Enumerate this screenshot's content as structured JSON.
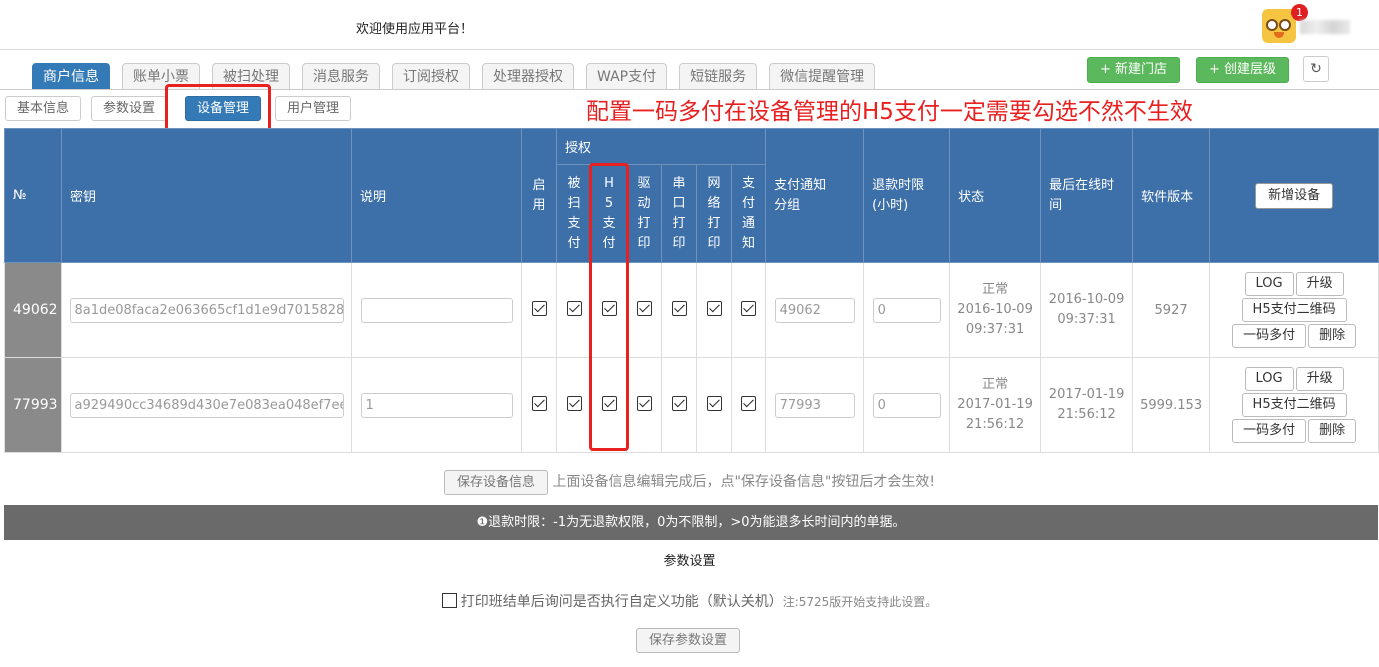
{
  "header": {
    "welcome": "欢迎使用应用平台！",
    "notification_count": "1"
  },
  "tabs": [
    "商户信息",
    "账单小票",
    "被扫处理",
    "消息服务",
    "订阅授权",
    "处理器授权",
    "WAP支付",
    "短链服务",
    "微信提醒管理"
  ],
  "actions": {
    "new_store": "+ 新建门店",
    "create_level": "+ 创建层级",
    "refresh_icon": "refresh-icon"
  },
  "subtabs": [
    "基本信息",
    "参数设置",
    "设备管理",
    "用户管理"
  ],
  "annotation": "配置一码多付在设备管理的H5支付一定需要勾选不然不生效",
  "table": {
    "headers": {
      "no": "№",
      "key": "密钥",
      "desc": "说明",
      "enable": "启用",
      "auth": "授权",
      "scan": "被扫支付",
      "h5": "H5支付",
      "driver": "驱动打印",
      "serial": "串口打印",
      "network": "网络打印",
      "paynotify": "支付通知",
      "notify_group": "支付通知分组",
      "refund": "退款时限(小时)",
      "status": "状态",
      "last_online": "最后在线时间",
      "version": "软件版本",
      "add_device": "新增设备"
    },
    "rows": [
      {
        "no": "49062",
        "key": "8a1de08faca2e063665cf1d1e9d7015828",
        "desc": "",
        "group": "49062",
        "refund": "0",
        "status": "正常",
        "status_date": "2016-10-09",
        "status_time": "09:37:31",
        "online_date": "2016-10-09",
        "online_time": "09:37:31",
        "version": "5927"
      },
      {
        "no": "77993",
        "key": "a929490cc34689d430e7e083ea048ef7ee",
        "desc": "1",
        "group": "77993",
        "refund": "0",
        "status": "正常",
        "status_date": "2017-01-19",
        "status_time": "21:56:12",
        "online_date": "2017-01-19",
        "online_time": "21:56:12",
        "version": "5999.153"
      }
    ],
    "row_buttons": {
      "log": "LOG",
      "upgrade": "升级",
      "h5qr": "H5支付二维码",
      "multi": "一码多付",
      "delete": "删除"
    }
  },
  "save": {
    "button": "保存设备信息",
    "hint": "上面设备信息编辑完成后，点\"保存设备信息\"按钮后才会生效!"
  },
  "info": "❶退款时限：-1为无退款权限，0为不限制，>0为能退多长时间内的单据。",
  "params": {
    "title": "参数设置",
    "option": "打印班结单后询问是否执行自定义功能（默认关机）",
    "note": "注:5725版开始支持此设置。",
    "save": "保存参数设置"
  },
  "colors": {
    "primary": "#337ab7",
    "header_bg": "#3d6fa8",
    "green": "#5cb85c",
    "annotation_red": "#e82020"
  }
}
